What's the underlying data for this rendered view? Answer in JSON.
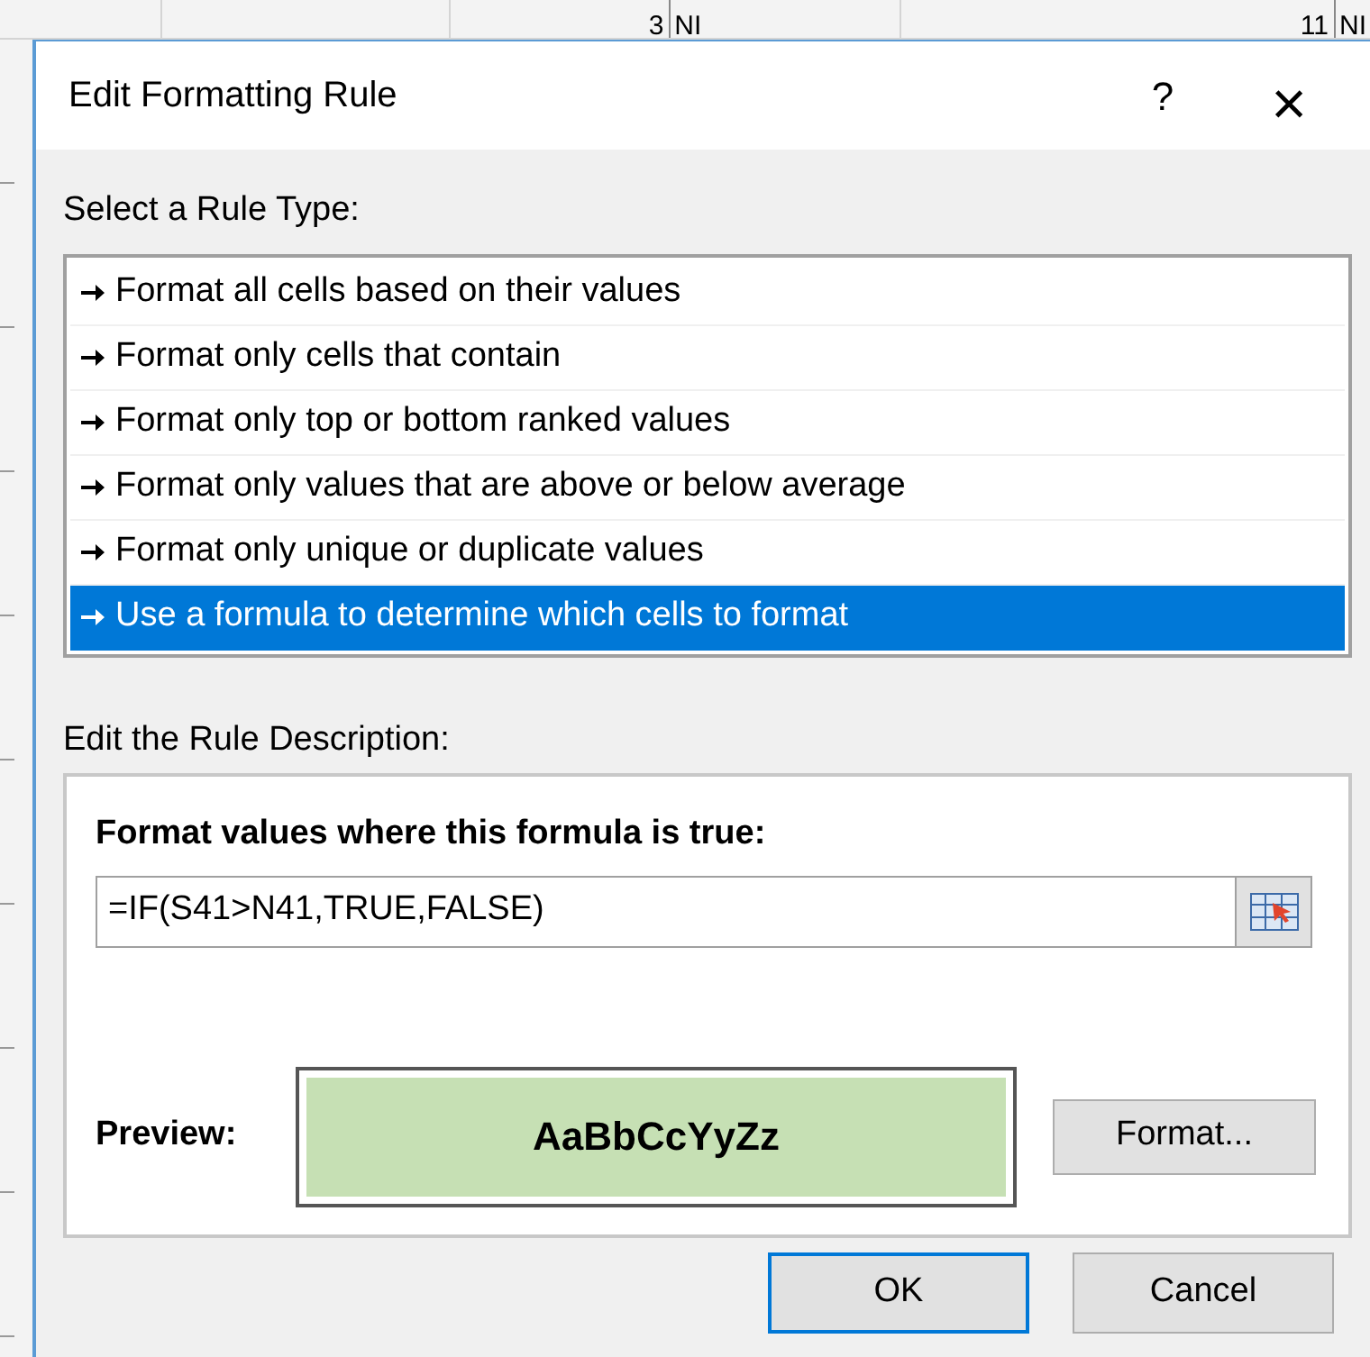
{
  "background_sheet": {
    "cells": [
      "3",
      "NI",
      "11",
      "NI"
    ]
  },
  "window": {
    "title": "Edit Formatting Rule",
    "help_button": "?",
    "close_button": "×"
  },
  "rule_type": {
    "label": "Select a Rule Type:",
    "items": [
      {
        "label": "Format all cells based on their values",
        "selected": false
      },
      {
        "label": "Format only cells that contain",
        "selected": false
      },
      {
        "label": "Format only top or bottom ranked values",
        "selected": false
      },
      {
        "label": "Format only values that are above or below average",
        "selected": false
      },
      {
        "label": "Format only unique or duplicate values",
        "selected": false
      },
      {
        "label": "Use a formula to determine which cells to format",
        "selected": true
      }
    ]
  },
  "description": {
    "label": "Edit the Rule Description:",
    "formula_label": "Format values where this formula is true:",
    "formula": "=IF(S41>N41,TRUE,FALSE)",
    "preview_label": "Preview:",
    "preview_text": "AaBbCcYyZz",
    "format_button": "Format..."
  },
  "buttons": [
    {
      "label": "OK",
      "default": true
    },
    {
      "label": "Cancel",
      "default": false
    }
  ]
}
